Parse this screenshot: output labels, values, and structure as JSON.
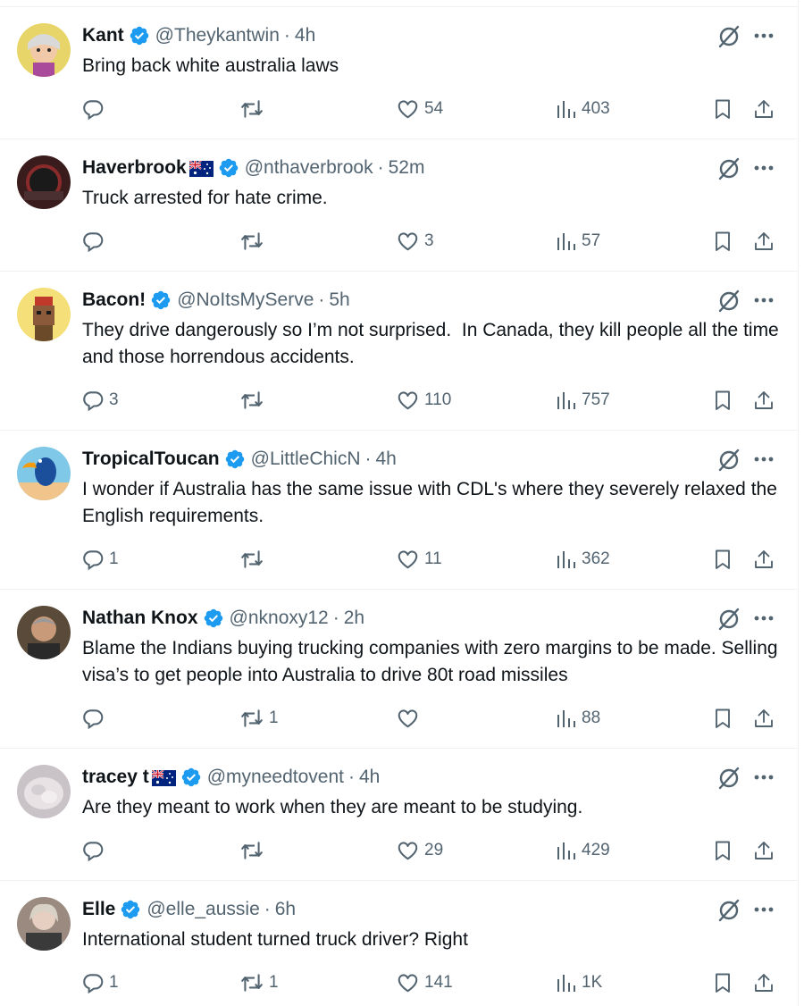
{
  "tweets": [
    {
      "name": "Kant",
      "flag": "",
      "handle": "@Theykantwin",
      "time": "4h",
      "text": "Bring back white australia laws",
      "replies": "",
      "retweets": "",
      "likes": "54",
      "views": "403",
      "avatar_color": "#e8d56a"
    },
    {
      "name": "Haverbrook",
      "flag": "au-flag",
      "handle": "@nthaverbrook",
      "time": "52m",
      "text": "Truck arrested for hate crime.",
      "replies": "",
      "retweets": "",
      "likes": "3",
      "views": "57",
      "avatar_color": "#3a1c1c"
    },
    {
      "name": "Bacon!",
      "flag": "",
      "handle": "@NoItsMyServe",
      "time": "5h",
      "text": "They drive dangerously so I’m not surprised.  In Canada, they kill people all the time and those horrendous accidents.",
      "replies": "3",
      "retweets": "",
      "likes": "110",
      "views": "757",
      "avatar_color": "#f4df78"
    },
    {
      "name": "TropicalToucan",
      "flag": "",
      "handle": "@LittleChicN",
      "time": "4h",
      "text": "I wonder if Australia has the same issue with CDL's where they severely relaxed the English requirements.",
      "replies": "1",
      "retweets": "",
      "likes": "11",
      "views": "362",
      "avatar_color": "#7fc8e8"
    },
    {
      "name": "Nathan Knox",
      "flag": "",
      "handle": "@nknoxy12",
      "time": "2h",
      "text": "Blame the Indians buying trucking companies with zero margins to be made. Selling visa’s to get people into Australia to drive 80t road missiles",
      "replies": "",
      "retweets": "1",
      "likes": "",
      "views": "88",
      "avatar_color": "#5a4a3a"
    },
    {
      "name": "tracey t",
      "flag": "au-flag",
      "handle": "@myneedtovent",
      "time": "4h",
      "text": "Are they meant to work when they are meant to be studying.",
      "replies": "",
      "retweets": "",
      "likes": "29",
      "views": "429",
      "avatar_color": "#c9c3c8"
    },
    {
      "name": "Elle",
      "flag": "",
      "handle": "@elle_aussie",
      "time": "6h",
      "text": "International student turned truck driver? Right",
      "replies": "1",
      "retweets": "1",
      "likes": "141",
      "views": "1K",
      "avatar_color": "#9a8a80"
    }
  ],
  "icons": {
    "verified": "verified-badge-icon",
    "grok": "grok-icon",
    "more": "more-options-icon",
    "reply": "reply-icon",
    "retweet": "retweet-icon",
    "like": "heart-icon",
    "views": "views-icon",
    "bookmark": "bookmark-icon",
    "share": "share-icon"
  },
  "colors": {
    "verified": "#1d9bf0",
    "secondary_text": "#536471",
    "primary_text": "#0f1419",
    "border": "#eff3f4"
  }
}
